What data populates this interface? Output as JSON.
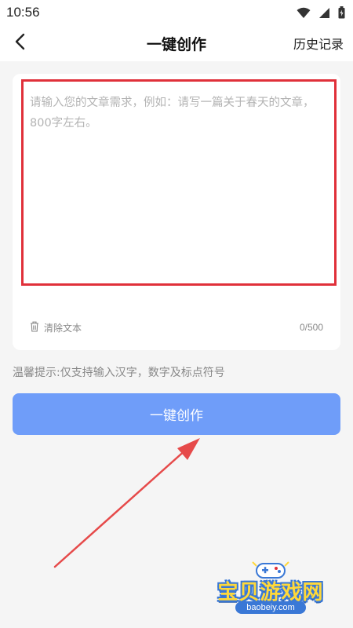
{
  "status_bar": {
    "time": "10:56",
    "icons": [
      "wifi-icon",
      "signal-icon",
      "battery-icon"
    ]
  },
  "nav": {
    "back_icon": "chevron-left-icon",
    "title": "一键创作",
    "history_label": "历史记录"
  },
  "editor": {
    "placeholder": "请输入您的文章需求，例如：请写一篇关于春天的文章，800字左右。",
    "value": "",
    "clear_icon": "trash-icon",
    "clear_label": "清除文本",
    "counter": "0/500"
  },
  "tip": "温馨提示:仅支持输入汉字，数字及标点符号",
  "create_button": {
    "label": "一键创作",
    "color": "#6f9df9"
  },
  "annotation": {
    "highlight_color": "#e0303a"
  },
  "watermark": {
    "text": "宝贝游戏网",
    "url": "baobeiy.com"
  }
}
